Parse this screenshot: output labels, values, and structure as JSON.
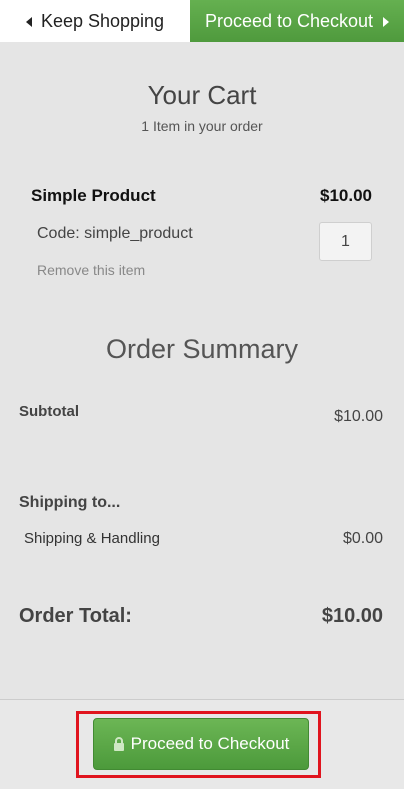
{
  "header": {
    "keep_shopping_label": "Keep Shopping",
    "checkout_label": "Proceed to Checkout"
  },
  "cart": {
    "title": "Your Cart",
    "item_count_text": "1 Item in your order",
    "items": [
      {
        "name": "Simple Product",
        "price": "$10.00",
        "code": "Code: simple_product",
        "quantity": "1",
        "remove_label": "Remove this item"
      }
    ]
  },
  "summary": {
    "title": "Order Summary",
    "subtotal_label": "Subtotal",
    "subtotal_value": "$10.00",
    "shipping_to_label": "Shipping to...",
    "shipping_label": "Shipping & Handling",
    "shipping_value": "$0.00",
    "order_total_label": "Order Total:",
    "order_total_value": "$10.00"
  },
  "footer": {
    "checkout_label": "Proceed to Checkout"
  },
  "icons": {
    "lock": "lock-icon",
    "left_arrow": "caret-left-icon",
    "right_arrow": "caret-right-icon"
  },
  "colors": {
    "accent_green": "#5ca64a",
    "highlight_red": "#e0141e",
    "background": "#e5e5e5"
  }
}
